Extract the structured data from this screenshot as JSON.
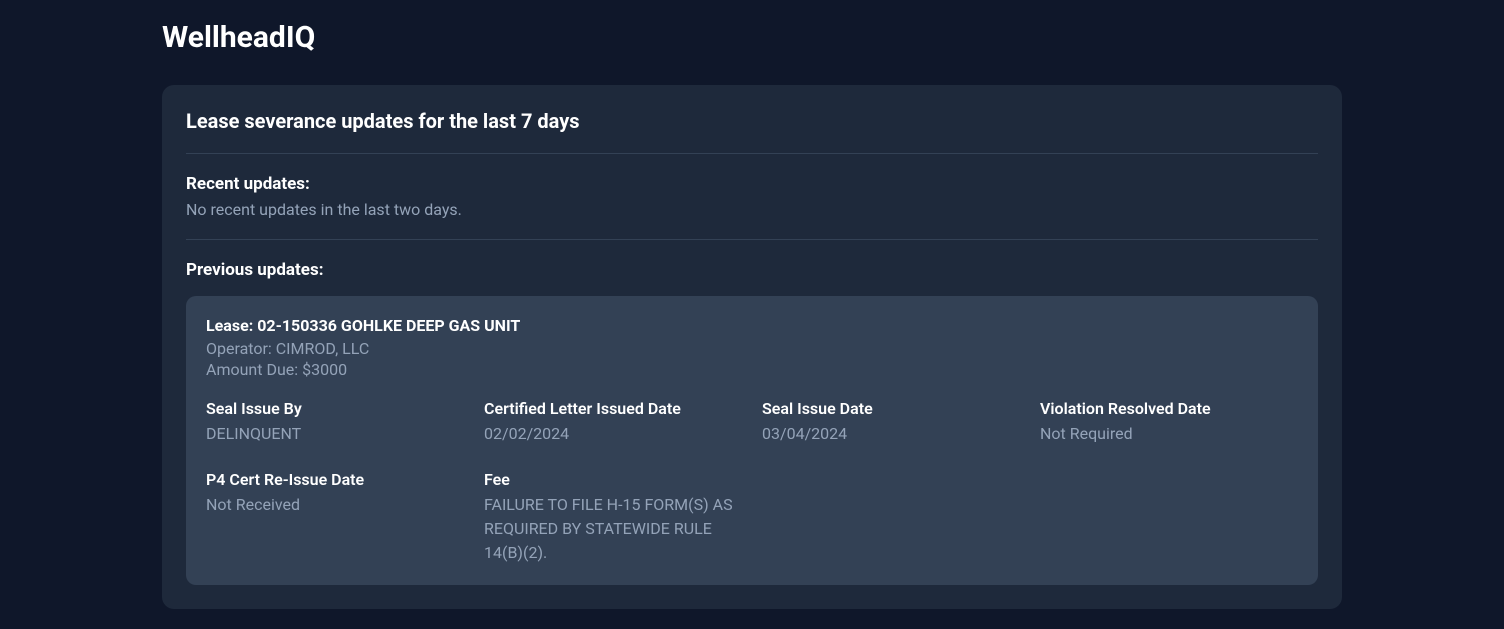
{
  "brand": "WellheadIQ",
  "card": {
    "title": "Lease severance updates for the last 7 days",
    "recent": {
      "title": "Recent updates:",
      "message": "No recent updates in the last two days."
    },
    "previous": {
      "title": "Previous updates:",
      "updates": [
        {
          "lease_label": "Lease: 02-150336 GOHLKE DEEP GAS UNIT",
          "operator": "Operator: CIMROD, LLC",
          "amount_due": "Amount Due: $3000",
          "fields": {
            "seal_issue_by": {
              "label": "Seal Issue By",
              "value": "DELINQUENT"
            },
            "certified_letter_issued_date": {
              "label": "Certified Letter Issued Date",
              "value": "02/02/2024"
            },
            "seal_issue_date": {
              "label": "Seal Issue Date",
              "value": "03/04/2024"
            },
            "violation_resolved_date": {
              "label": "Violation Resolved Date",
              "value": "Not Required"
            },
            "p4_cert_reissue_date": {
              "label": "P4 Cert Re-Issue Date",
              "value": "Not Received"
            },
            "fee": {
              "label": "Fee",
              "value": "FAILURE TO FILE H-15 FORM(S) AS REQUIRED BY STATEWIDE RULE 14(B)(2)."
            }
          }
        }
      ]
    }
  }
}
